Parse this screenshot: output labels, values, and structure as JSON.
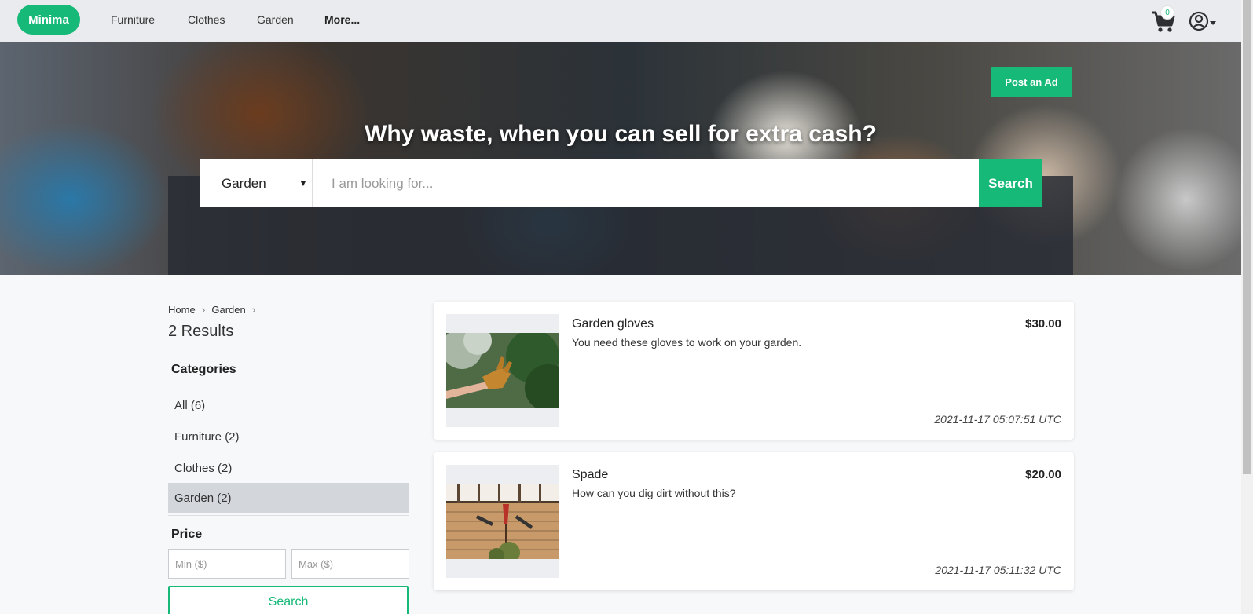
{
  "navbar": {
    "brand": "Minima",
    "links": [
      "Furniture",
      "Clothes",
      "Garden",
      "More..."
    ],
    "cart_count": "0",
    "cart_icon": "cart-icon",
    "user_icon": "user-circle-icon"
  },
  "hero": {
    "post_ad_label": "Post an Ad",
    "title": "Why waste, when you can sell for extra cash?",
    "category_selected": "Garden",
    "search_placeholder": "I am looking for...",
    "search_label": "Search"
  },
  "sidebar": {
    "breadcrumb": [
      "Home",
      "Garden"
    ],
    "results_label": "2 Results",
    "categories_title": "Categories",
    "categories": [
      {
        "label": "All (6)",
        "active": false
      },
      {
        "label": "Furniture (2)",
        "active": false
      },
      {
        "label": "Clothes (2)",
        "active": false
      },
      {
        "label": "Garden (2)",
        "active": true
      }
    ],
    "price_title": "Price",
    "min_placeholder": "Min ($)",
    "max_placeholder": "Max ($)",
    "search_label": "Search"
  },
  "listings": [
    {
      "title": "Garden gloves",
      "description": "You need these gloves to work on your garden.",
      "price": "$30.00",
      "date": "2021-11-17 05:07:51 UTC"
    },
    {
      "title": "Spade",
      "description": "How can you dig dirt without this?",
      "price": "$20.00",
      "date": "2021-11-17 05:11:32 UTC"
    }
  ],
  "colors": {
    "accent": "#17b978",
    "navbar_bg": "#e9ebef",
    "page_bg": "#f7f8fa"
  }
}
